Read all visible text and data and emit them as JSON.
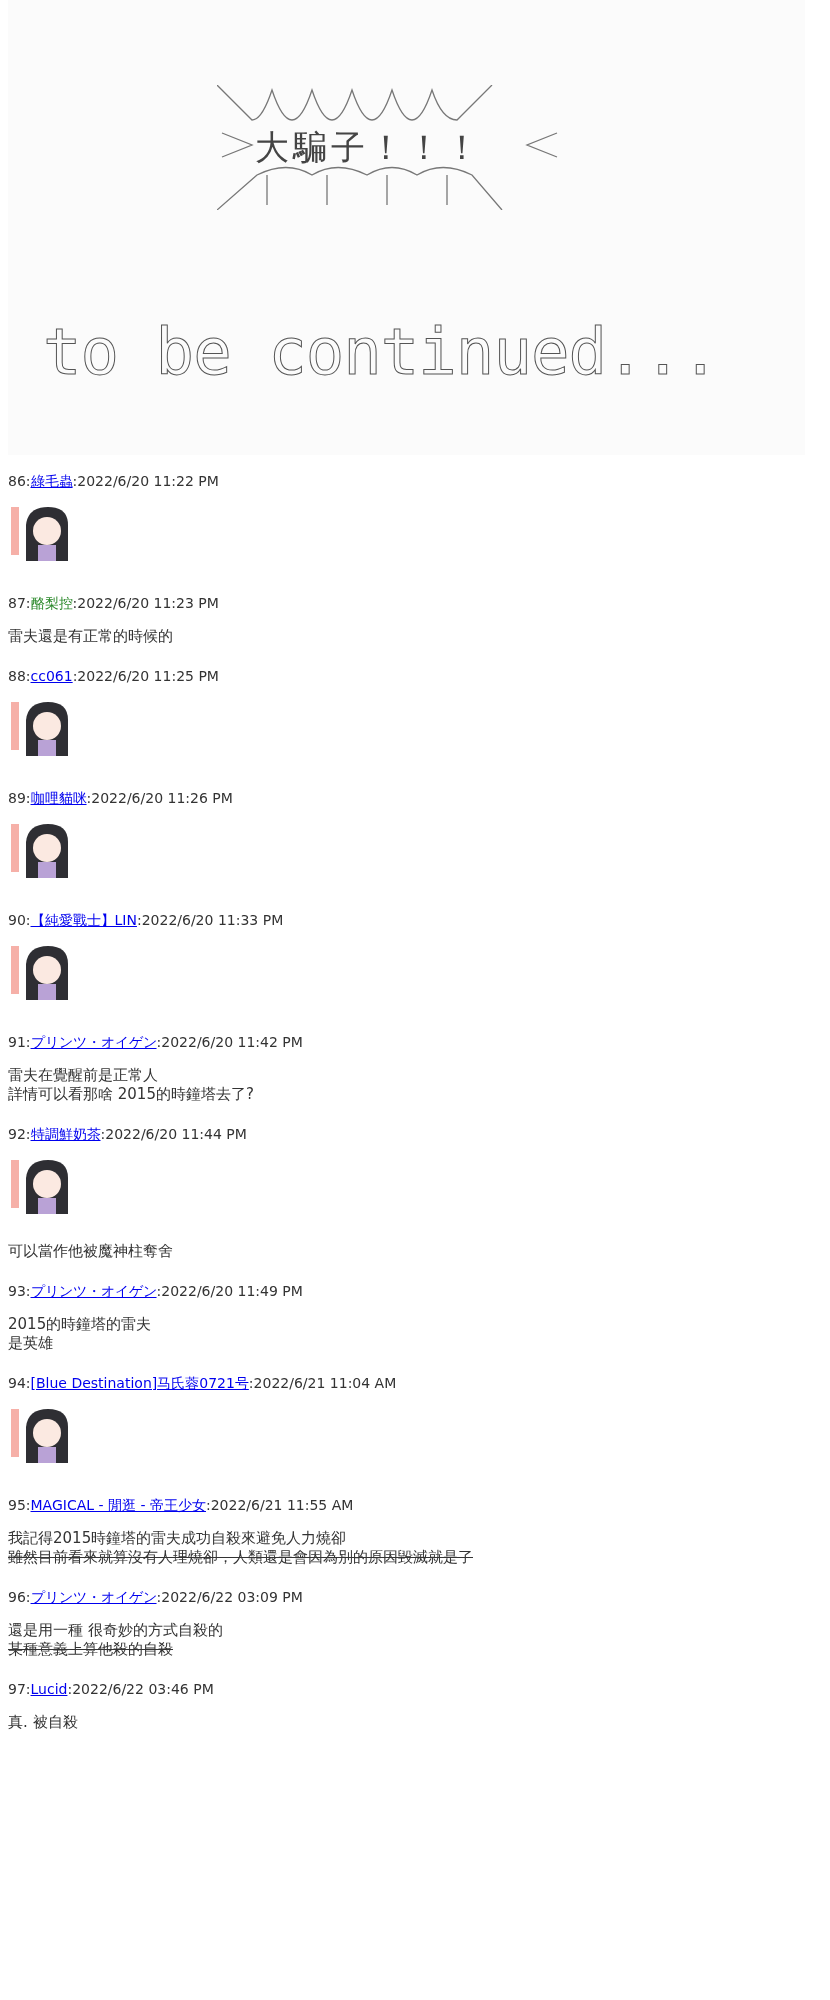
{
  "art": {
    "shout": "大騙子！！！",
    "caption": "to be continued..."
  },
  "posts": [
    {
      "number": "86:",
      "name": "綠毛蟲",
      "linked": true,
      "time": ":2022/6/20 11:22 PM",
      "content": [
        {
          "kind": "sticker"
        }
      ]
    },
    {
      "number": "87:",
      "name": "酪梨控",
      "linked": false,
      "time": ":2022/6/20 11:23 PM",
      "content": [
        {
          "kind": "text",
          "lines": [
            {
              "text": "雷夫還是有正常的時候的",
              "struck": false
            }
          ]
        }
      ]
    },
    {
      "number": "88:",
      "name": "cc061",
      "linked": true,
      "time": ":2022/6/20 11:25 PM",
      "content": [
        {
          "kind": "sticker"
        }
      ]
    },
    {
      "number": "89:",
      "name": "咖哩貓咪",
      "linked": true,
      "time": ":2022/6/20 11:26 PM",
      "content": [
        {
          "kind": "sticker"
        }
      ]
    },
    {
      "number": "90:",
      "name": "【純愛戰士】LIN",
      "linked": true,
      "time": ":2022/6/20 11:33 PM",
      "content": [
        {
          "kind": "sticker"
        }
      ]
    },
    {
      "number": "91:",
      "name": "プリンツ・オイゲン",
      "linked": true,
      "time": ":2022/6/20 11:42 PM",
      "content": [
        {
          "kind": "text",
          "lines": [
            {
              "text": "雷夫在覺醒前是正常人",
              "struck": false
            },
            {
              "text": "詳情可以看那啥 2015的時鐘塔去了?",
              "struck": false
            }
          ]
        }
      ]
    },
    {
      "number": "92:",
      "name": "特調鮮奶茶",
      "linked": true,
      "time": ":2022/6/20 11:44 PM",
      "content": [
        {
          "kind": "sticker"
        },
        {
          "kind": "text",
          "lines": [
            {
              "text": "可以當作他被魔神柱奪舍",
              "struck": false
            }
          ]
        }
      ]
    },
    {
      "number": "93:",
      "name": "プリンツ・オイゲン",
      "linked": true,
      "time": ":2022/6/20 11:49 PM",
      "content": [
        {
          "kind": "text",
          "lines": [
            {
              "text": "2015的時鐘塔的雷夫",
              "struck": false
            },
            {
              "text": "是英雄",
              "struck": false
            }
          ]
        }
      ]
    },
    {
      "number": "94:",
      "name": "[Blue Destination]马氏蓉0721号",
      "linked": true,
      "time": ":2022/6/21 11:04 AM",
      "content": [
        {
          "kind": "sticker"
        }
      ]
    },
    {
      "number": "95:",
      "name": "MAGICAL - 閒逛 - 帝王少女",
      "linked": true,
      "time": ":2022/6/21 11:55 AM",
      "content": [
        {
          "kind": "text",
          "lines": [
            {
              "text": "我記得2015時鐘塔的雷夫成功自殺來避免人力燒卻",
              "struck": false
            },
            {
              "text": "雖然目前看來就算沒有人理燒卻，人類還是會因為別的原因毀滅就是了",
              "struck": true
            }
          ]
        }
      ]
    },
    {
      "number": "96:",
      "name": "プリンツ・オイゲン",
      "linked": true,
      "time": ":2022/6/22 03:09 PM",
      "content": [
        {
          "kind": "text",
          "lines": [
            {
              "text": "還是用一種 很奇妙的方式自殺的",
              "struck": false
            },
            {
              "text": "某種意義上算他殺的自殺",
              "struck": true
            }
          ]
        }
      ]
    },
    {
      "number": "97:",
      "name": "Lucid",
      "linked": true,
      "time": ":2022/6/22 03:46 PM",
      "content": [
        {
          "kind": "text",
          "lines": [
            {
              "text": "真. 被自殺",
              "struck": false
            }
          ]
        }
      ]
    }
  ]
}
